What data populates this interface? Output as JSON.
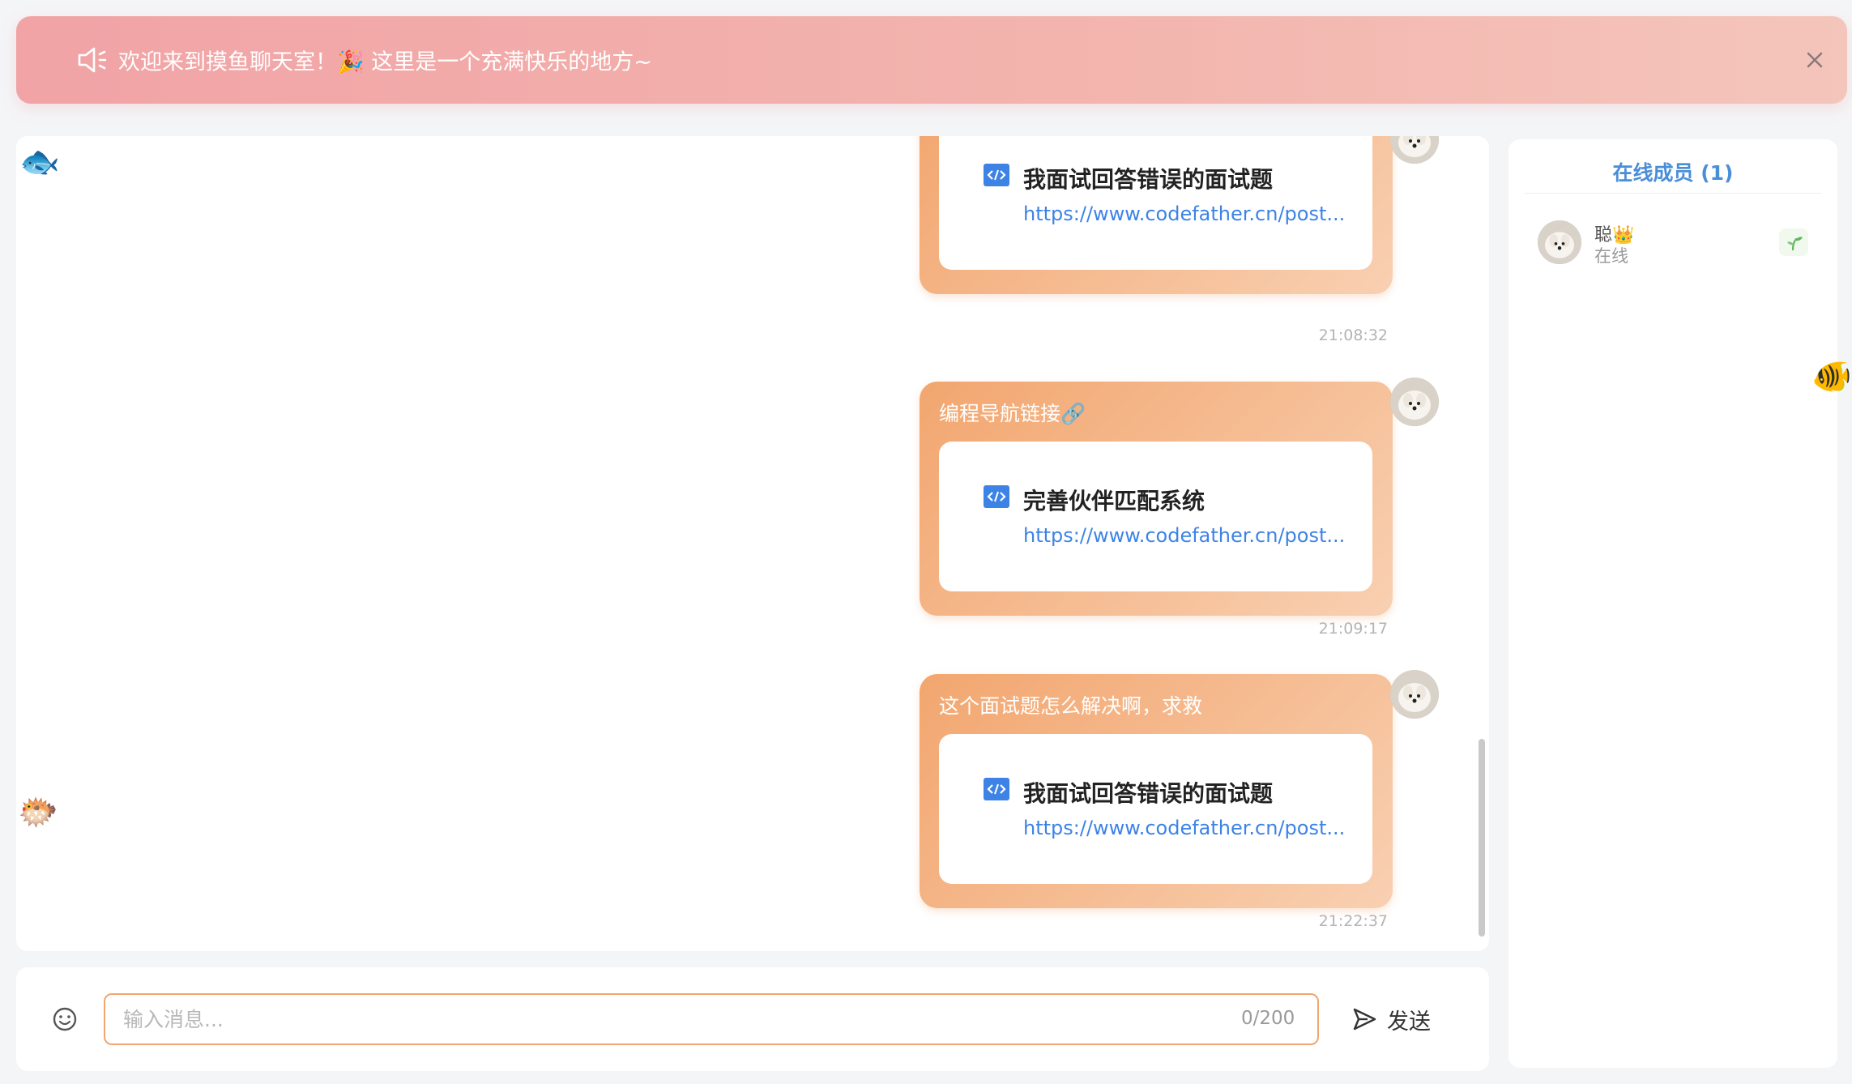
{
  "announcement": {
    "text": "欢迎来到摸鱼聊天室！🎉 这里是一个充满快乐的地方~",
    "speaker_icon": "speaker-icon",
    "close_icon": "close-icon"
  },
  "messages": [
    {
      "text": "",
      "card": {
        "title": "我面试回答错误的面试题",
        "url": "https://www.codefather.cn/post..."
      },
      "time": "21:08:32"
    },
    {
      "text": "编程导航链接🔗",
      "card": {
        "title": "完善伙伴匹配系统",
        "url": "https://www.codefather.cn/post..."
      },
      "time": "21:09:17"
    },
    {
      "text": "这个面试题怎么解决啊，求救",
      "card": {
        "title": "我面试回答错误的面试题",
        "url": "https://www.codefather.cn/post..."
      },
      "time": "21:22:37"
    }
  ],
  "decorations": {
    "fish_top": "🐟",
    "fish_bottom": "🐡",
    "fish_right": "🐠"
  },
  "input": {
    "placeholder": "输入消息...",
    "counter": "0/200",
    "send_label": "发送",
    "emoji_icon": "smiley-icon",
    "send_icon": "send-icon"
  },
  "members": {
    "title": "在线成员 (1)",
    "list": [
      {
        "name": "聪👑",
        "status": "在线",
        "badge_icon": "sprout-icon"
      }
    ]
  },
  "colors": {
    "banner_start": "#f1a3a6",
    "banner_end": "#f4c5bb",
    "bubble_start": "#f2a66f",
    "bubble_end": "#f8d0b2",
    "link": "#3d83e6",
    "members_title": "#4a8ed8"
  }
}
